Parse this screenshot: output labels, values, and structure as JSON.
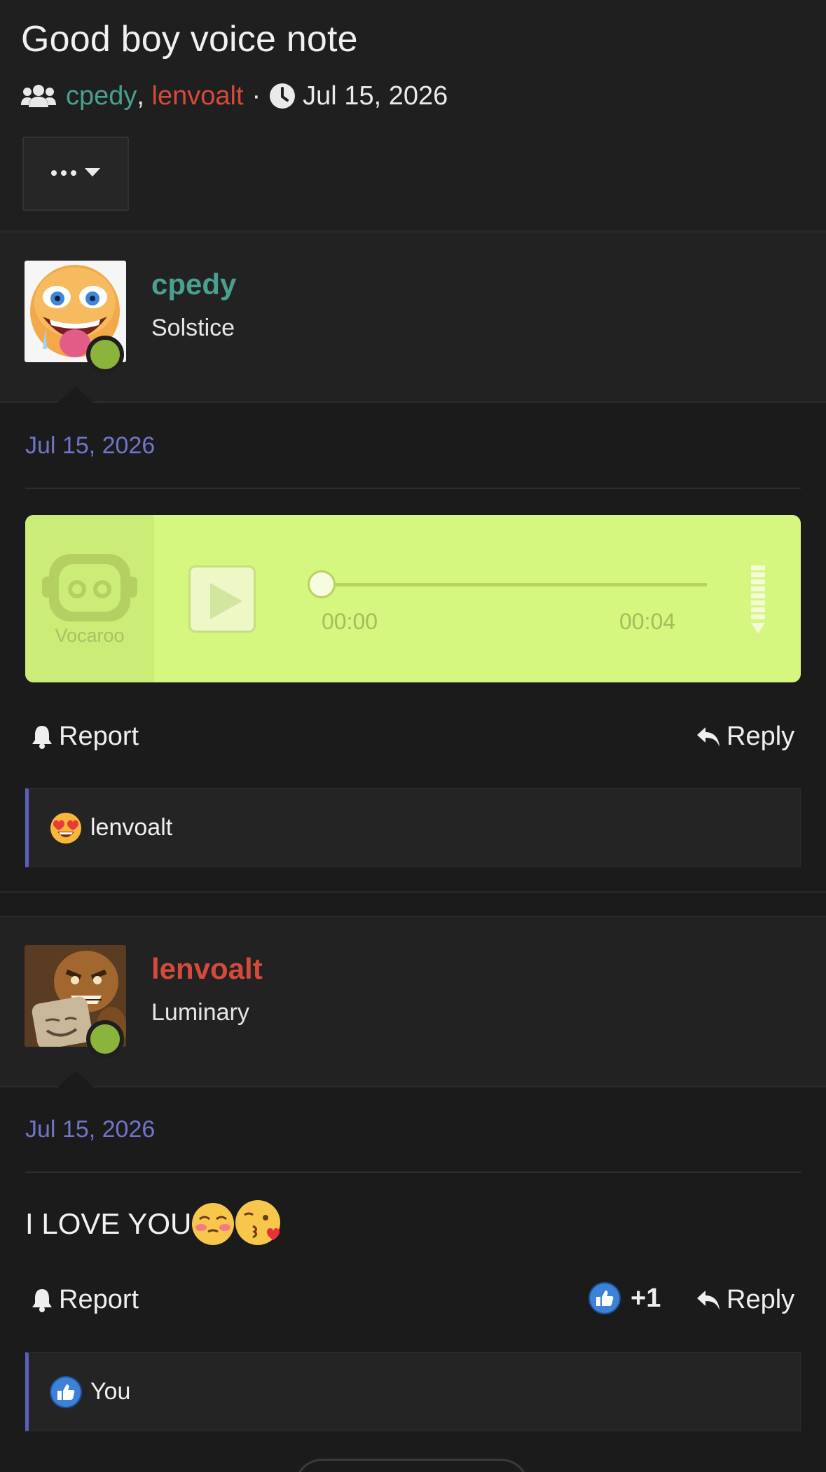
{
  "thread": {
    "title": "Good boy voice note",
    "participants": [
      "cpedy",
      "lenvoalt"
    ],
    "separator": "·",
    "date": "Jul 15, 2026"
  },
  "posts": [
    {
      "username": "cpedy",
      "user_title": "Solstice",
      "user_color": "#4aa08e",
      "date": "Jul 15, 2026",
      "embed": {
        "provider": "Vocaroo",
        "time_current": "00:00",
        "time_total": "00:04",
        "progress": 0
      },
      "actions": {
        "report": "Report",
        "reply": "Reply"
      },
      "reactions": {
        "icon": "heart-eyes-emoji",
        "users": "lenvoalt"
      }
    },
    {
      "username": "lenvoalt",
      "user_title": "Luminary",
      "user_color": "#d64a3b",
      "date": "Jul 15, 2026",
      "text": "I LOVE YOU",
      "text_emojis": [
        "blushing-emoji",
        "kissing-heart-emoji"
      ],
      "actions": {
        "report": "Report",
        "like_count": "+1",
        "reply": "Reply"
      },
      "reactions": {
        "icon": "thumbs-up-icon",
        "users": "You"
      }
    }
  ],
  "colors": {
    "accent": "#5a5fbf",
    "date": "#7075c8",
    "online": "#8ab43c",
    "vocaroo_bg": "#d5f77f"
  }
}
